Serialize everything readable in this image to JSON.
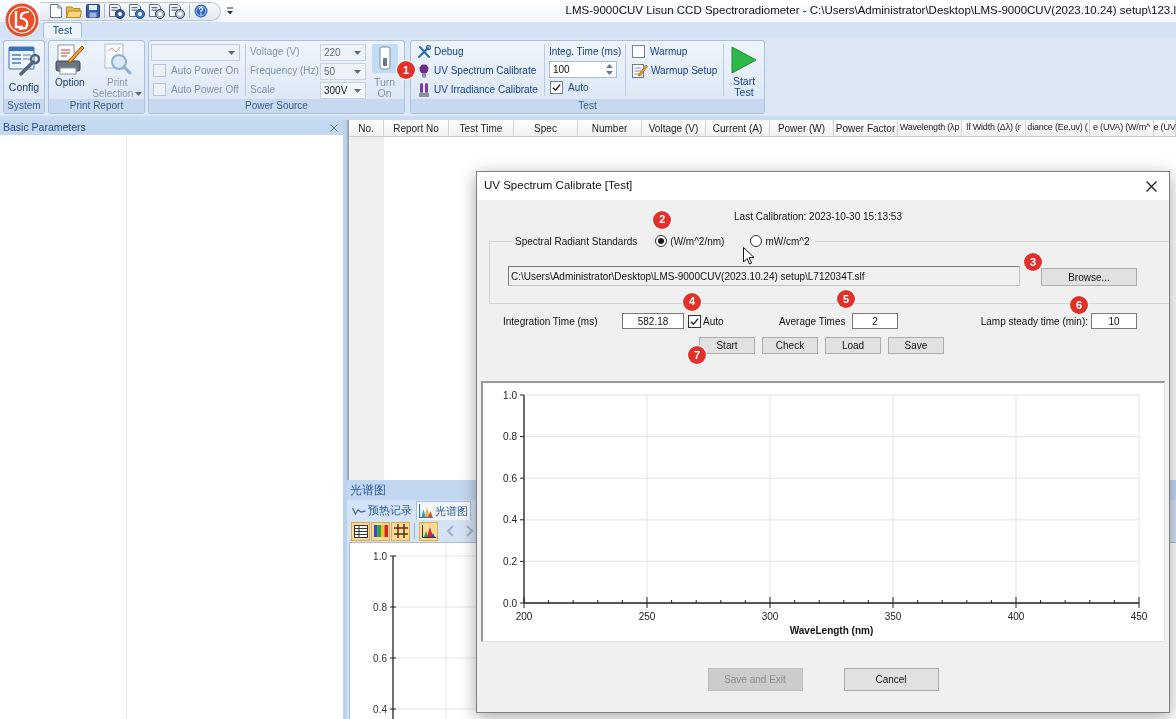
{
  "window": {
    "title": "LMS-9000CUV Lisun CCD Spectroradiometer - C:\\Users\\Administrator\\Desktop\\LMS-9000CUV(2023.10.24) setup\\123.l"
  },
  "ribbon": {
    "tabs": [
      {
        "label": "Test",
        "selected": true
      }
    ],
    "groups": [
      {
        "kind": "system",
        "label": "System",
        "buttons": [
          {
            "label": "Config",
            "disabled": false
          }
        ]
      },
      {
        "kind": "print",
        "label": "Print Report",
        "buttons": [
          {
            "label": "Option",
            "disabled": false,
            "menu": false
          },
          {
            "label": "Print Selection",
            "disabled": true,
            "menu": true
          }
        ]
      },
      {
        "kind": "power",
        "label": "Power Source",
        "device_select": {
          "disabled": true
        },
        "checkboxes": [
          {
            "label": "Auto Power On",
            "checked": false,
            "disabled": true
          },
          {
            "label": "Auto Power Off",
            "checked": false,
            "disabled": true
          }
        ],
        "fields": [
          {
            "label": "Voltage (V)",
            "value": "220",
            "disabled": true
          },
          {
            "label": "Frequency (Hz)",
            "value": "50",
            "disabled": true
          },
          {
            "label": "Scale",
            "value": "300V",
            "disabled": false
          }
        ],
        "switch": {
          "label": "Turn On",
          "disabled": true
        }
      },
      {
        "kind": "test",
        "label": "Test",
        "commands": [
          {
            "label": "Debug"
          },
          {
            "label": "UV Spectrum Calibrate",
            "marker": "1"
          },
          {
            "label": "UV Irradiance Calibrate"
          }
        ],
        "integ_time": {
          "label": "Integ. Time (ms)",
          "value": "100"
        },
        "auto": {
          "label": "Auto",
          "checked": true
        },
        "warmup": {
          "label": "Warmup",
          "checked": false
        },
        "warmup_setup": {
          "label": "Warmup Setup"
        },
        "start": {
          "label": "Start Test"
        }
      }
    ]
  },
  "side_panel": {
    "title": "Basic Parameters"
  },
  "table": {
    "columns": [
      "No.",
      "Report No",
      "Test Time",
      "Spec",
      "Number",
      "Voltage (V)",
      "Current (A)",
      "Power (W)",
      "Power Factor",
      "Wavelength (λp",
      "lf Width (Δλ) (r",
      "diance (Ee,uv) (",
      "e (UVA) (W/m^",
      "e (UV"
    ]
  },
  "spectrum_panel": {
    "title": "光谱图",
    "tabs": [
      {
        "label": "预热记录",
        "selected": false
      },
      {
        "label": "光谱图",
        "selected": true
      }
    ],
    "axis_labels": [
      "1.0",
      "0.8",
      "0.6",
      "0.4"
    ]
  },
  "dialog": {
    "title": "UV Spectrum Calibrate [Test]",
    "last_calibration": "Last Calibration: 2023-10-30 15:13:53",
    "standards": {
      "label": "Spectral Radiant Standards",
      "options": [
        {
          "label": "(W/m^2/nm)",
          "selected": true,
          "marker": "2"
        },
        {
          "label": "mW/cm^2",
          "selected": false
        }
      ],
      "file_path": "C:\\Users\\Administrator\\Desktop\\LMS-9000CUV(2023.10.24) setup\\L712034T.slf",
      "browse": {
        "label": "Browse...",
        "marker": "3"
      }
    },
    "integration_time": {
      "label": "Integration Time (ms)",
      "value": "582.18"
    },
    "auto": {
      "label": "Auto",
      "checked": true,
      "marker": "4"
    },
    "average_times": {
      "label": "Average Times",
      "value": "2",
      "marker": "5"
    },
    "lamp_steady_time": {
      "label": "Lamp steady time (min):",
      "value": "10",
      "marker": "6"
    },
    "actions": [
      {
        "label": "Start",
        "marker": "7"
      },
      {
        "label": "Check"
      },
      {
        "label": "Load"
      },
      {
        "label": "Save"
      }
    ],
    "chart_data": {
      "type": "line",
      "xlabel": "WaveLength (nm)",
      "xlim": [
        200,
        450
      ],
      "ylim": [
        0,
        1
      ],
      "grid": true,
      "xticks": [
        200,
        250,
        300,
        350,
        400,
        450
      ],
      "yticks": [
        {
          "value": 0,
          "label": "0.0"
        },
        {
          "value": 0.2,
          "label": "0.2"
        },
        {
          "value": 0.4,
          "label": "0.4"
        },
        {
          "value": 0.6,
          "label": "0.6"
        },
        {
          "value": 0.8,
          "label": "0.8"
        },
        {
          "value": 1.0,
          "label": "1.0"
        }
      ]
    },
    "footer_buttons": [
      {
        "label": "Save and Exit",
        "disabled": true
      },
      {
        "label": "Cancel",
        "disabled": false
      }
    ]
  }
}
